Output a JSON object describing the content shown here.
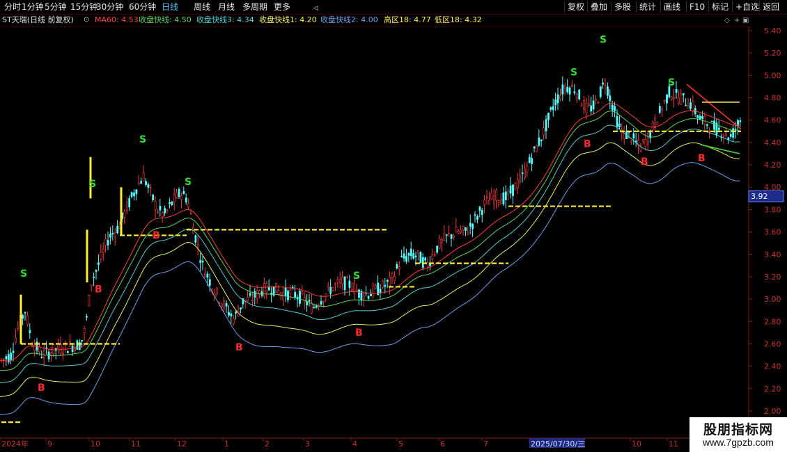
{
  "toolbar": {
    "left_items": [
      "分时",
      "1分钟",
      "5分钟",
      "15分钟",
      "30分钟",
      "60分钟",
      "日线",
      "周线",
      "月线",
      "多周期",
      "更多"
    ],
    "active": "日线",
    "right_items": [
      "复权",
      "叠加",
      "多股",
      "统计",
      "画线",
      "F10",
      "标记",
      "+自选",
      "返回"
    ]
  },
  "legend": {
    "title": "ST天瑞(日线 前复权)",
    "items": [
      {
        "label": "MA60: 4.53",
        "color": "#ff4040"
      },
      {
        "label": "收盘快线: 4.50",
        "color": "#5fd35f"
      },
      {
        "label": "收盘快线3: 4.34",
        "color": "#4fd0d0"
      },
      {
        "label": "收盘快线1: 4.20",
        "color": "#f0f060"
      },
      {
        "label": "收盘快线2: 4.00",
        "color": "#6e9ee8"
      },
      {
        "label": "高区18: 4.77",
        "color": "#ffee55"
      },
      {
        "label": "低区18: 4.32",
        "color": "#ffee55"
      }
    ]
  },
  "chart_data": {
    "type": "line",
    "y_ticks": [
      "5.40",
      "5.20",
      "5.00",
      "4.80",
      "4.60",
      "4.40",
      "4.20",
      "4.00",
      "3.80",
      "3.60",
      "3.40",
      "3.20",
      "3.00",
      "2.80",
      "2.60",
      "2.40",
      "2.20",
      "2.00"
    ],
    "ylim": [
      2.0,
      5.4
    ],
    "x_labels": [
      "2024年",
      "9",
      "10",
      "11",
      "12",
      "1",
      "2",
      "3",
      "4",
      "5",
      "6",
      "7",
      "2025/07/30/三",
      "10",
      "11"
    ],
    "x_label_positions": [
      0,
      66,
      128,
      186,
      252,
      320,
      378,
      436,
      504,
      570,
      630,
      692,
      760,
      905,
      958
    ],
    "current_price": "3.92",
    "close_key": [
      [
        0,
        2.45
      ],
      [
        15,
        2.5
      ],
      [
        25,
        2.75
      ],
      [
        35,
        2.9
      ],
      [
        45,
        2.62
      ],
      [
        60,
        2.5
      ],
      [
        80,
        2.55
      ],
      [
        100,
        2.58
      ],
      [
        115,
        2.6
      ],
      [
        122,
        2.75
      ],
      [
        130,
        3.15
      ],
      [
        140,
        3.3
      ],
      [
        155,
        3.55
      ],
      [
        170,
        3.65
      ],
      [
        180,
        3.8
      ],
      [
        195,
        4.0
      ],
      [
        205,
        4.1
      ],
      [
        215,
        3.95
      ],
      [
        225,
        3.8
      ],
      [
        235,
        3.75
      ],
      [
        245,
        3.85
      ],
      [
        258,
        3.95
      ],
      [
        268,
        3.9
      ],
      [
        278,
        3.6
      ],
      [
        290,
        3.3
      ],
      [
        305,
        3.1
      ],
      [
        320,
        2.95
      ],
      [
        335,
        2.82
      ],
      [
        348,
        2.98
      ],
      [
        360,
        3.0
      ],
      [
        375,
        3.08
      ],
      [
        390,
        3.1
      ],
      [
        405,
        3.05
      ],
      [
        420,
        3.05
      ],
      [
        435,
        3.0
      ],
      [
        448,
        2.92
      ],
      [
        460,
        3.0
      ],
      [
        475,
        3.1
      ],
      [
        490,
        3.15
      ],
      [
        505,
        3.12
      ],
      [
        515,
        3.05
      ],
      [
        530,
        3.05
      ],
      [
        545,
        3.1
      ],
      [
        560,
        3.15
      ],
      [
        575,
        3.35
      ],
      [
        590,
        3.4
      ],
      [
        600,
        3.38
      ],
      [
        612,
        3.3
      ],
      [
        625,
        3.45
      ],
      [
        640,
        3.55
      ],
      [
        655,
        3.6
      ],
      [
        668,
        3.6
      ],
      [
        680,
        3.7
      ],
      [
        695,
        3.85
      ],
      [
        710,
        3.92
      ],
      [
        725,
        3.9
      ],
      [
        738,
        4.0
      ],
      [
        750,
        4.1
      ],
      [
        765,
        4.3
      ],
      [
        780,
        4.5
      ],
      [
        795,
        4.75
      ],
      [
        810,
        4.9
      ],
      [
        825,
        4.88
      ],
      [
        840,
        4.7
      ],
      [
        852,
        4.72
      ],
      [
        868,
        4.95
      ],
      [
        880,
        4.7
      ],
      [
        890,
        4.5
      ],
      [
        905,
        4.45
      ],
      [
        918,
        4.35
      ],
      [
        930,
        4.45
      ],
      [
        945,
        4.65
      ],
      [
        960,
        4.85
      ],
      [
        975,
        4.8
      ],
      [
        990,
        4.75
      ],
      [
        1005,
        4.6
      ],
      [
        1020,
        4.55
      ],
      [
        1035,
        4.5
      ],
      [
        1048,
        4.45
      ],
      [
        1062,
        4.6
      ]
    ],
    "series": [
      {
        "name": "MA60",
        "offset": 0.0,
        "color": "#ff4040"
      },
      {
        "name": "收盘快线",
        "offset": 0.07,
        "color": "#5fd35f"
      },
      {
        "name": "收盘快线3",
        "offset": 0.18,
        "color": "#4fd0d0"
      },
      {
        "name": "收盘快线1",
        "offset": 0.32,
        "color": "#f0f060"
      },
      {
        "name": "收盘快线2",
        "offset": 0.5,
        "color": "#6e9ee8"
      }
    ],
    "signals": [
      {
        "t": "S",
        "x": 34,
        "y": 3.2
      },
      {
        "t": "S",
        "x": 133,
        "y": 4.0
      },
      {
        "t": "S",
        "x": 205,
        "y": 4.4
      },
      {
        "t": "S",
        "x": 270,
        "y": 4.02
      },
      {
        "t": "S",
        "x": 512,
        "y": 3.18
      },
      {
        "t": "S",
        "x": 824,
        "y": 5.0
      },
      {
        "t": "S",
        "x": 866,
        "y": 5.29
      },
      {
        "t": "S",
        "x": 964,
        "y": 4.91
      },
      {
        "t": "B",
        "x": 59,
        "y": 2.18
      },
      {
        "t": "B",
        "x": 141,
        "y": 3.06
      },
      {
        "t": "B",
        "x": 224,
        "y": 3.54
      },
      {
        "t": "B",
        "x": 343,
        "y": 2.54
      },
      {
        "t": "B",
        "x": 515,
        "y": 2.67
      },
      {
        "t": "B",
        "x": 843,
        "y": 4.36
      },
      {
        "t": "B",
        "x": 925,
        "y": 4.2
      },
      {
        "t": "B",
        "x": 1007,
        "y": 4.23
      }
    ],
    "support_lines": [
      {
        "x1": 2,
        "x2": 30,
        "y": 1.9
      },
      {
        "x1": 30,
        "x2": 172,
        "y": 2.6
      },
      {
        "x1": 172,
        "x2": 268,
        "y": 3.57
      },
      {
        "x1": 268,
        "x2": 558,
        "y": 3.62
      },
      {
        "x1": 558,
        "x2": 596,
        "y": 3.11
      },
      {
        "x1": 596,
        "x2": 730,
        "y": 3.32
      },
      {
        "x1": 730,
        "x2": 880,
        "y": 3.83
      },
      {
        "x1": 880,
        "x2": 1064,
        "y": 4.5
      }
    ],
    "support_verticals": [
      {
        "x": 30,
        "y1": 2.6,
        "y2": 3.04
      },
      {
        "x": 125,
        "y1": 3.15,
        "y2": 3.62
      },
      {
        "x": 130,
        "y1": 3.9,
        "y2": 4.27
      },
      {
        "x": 174,
        "y1": 3.57,
        "y2": 4.0
      }
    ],
    "trend_lines": [
      {
        "x1": 986,
        "y1": 4.92,
        "x2": 1064,
        "y2": 4.52,
        "color": "#ff3030"
      },
      {
        "x1": 1008,
        "y1": 4.76,
        "x2": 1062,
        "y2": 4.76,
        "color": "#f0e060"
      },
      {
        "x1": 1006,
        "y1": 4.38,
        "x2": 1062,
        "y2": 4.3,
        "color": "#40e040"
      }
    ]
  }
}
